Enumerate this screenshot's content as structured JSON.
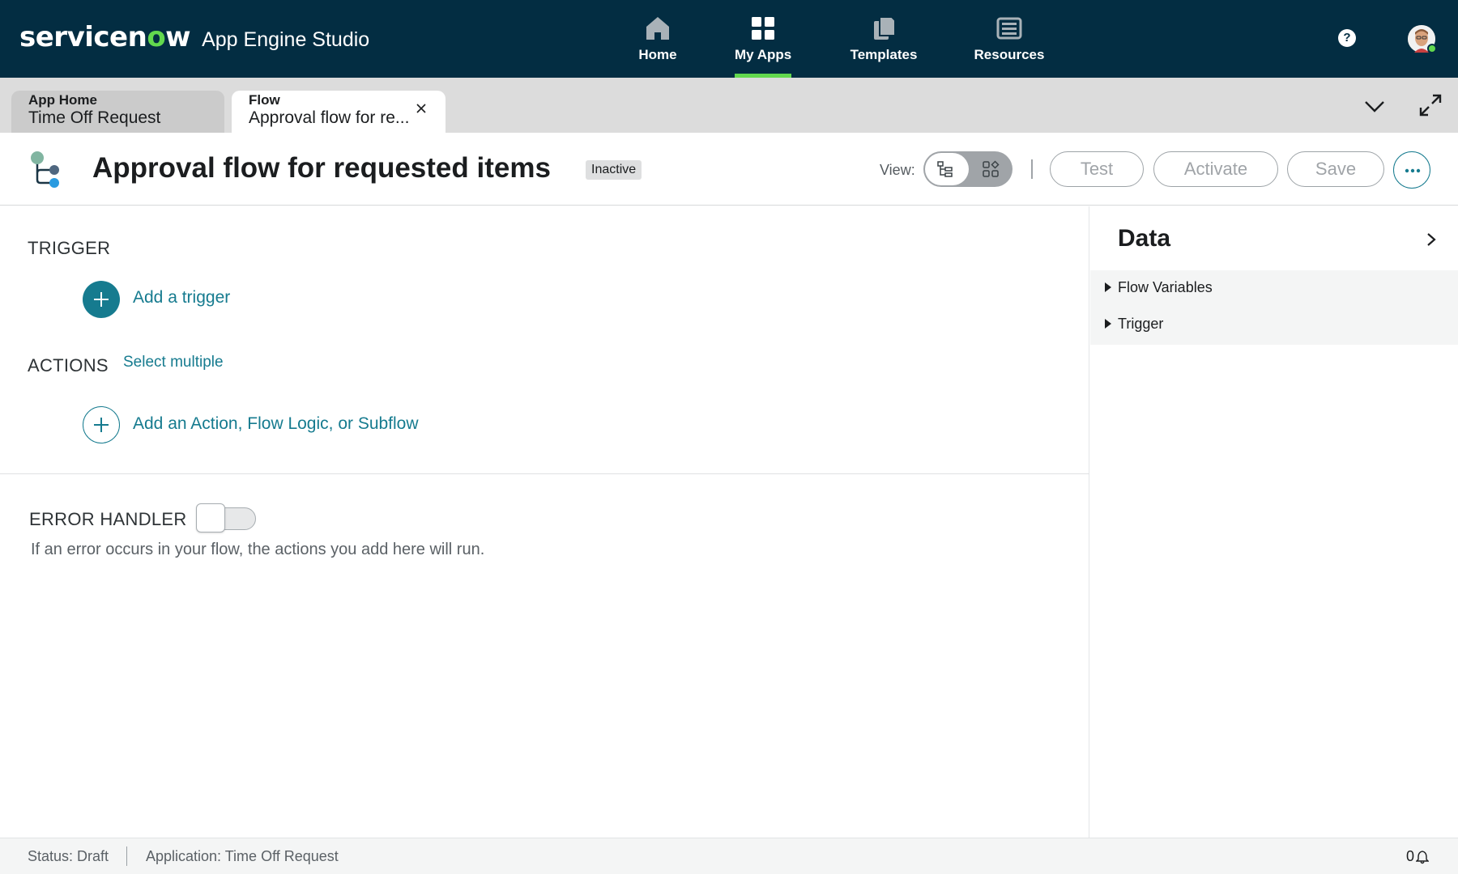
{
  "brand": {
    "logo_prefix": "servicen",
    "logo_o": "o",
    "logo_suffix": "w",
    "app_name": "App Engine Studio"
  },
  "nav": {
    "items": [
      {
        "label": "Home",
        "icon": "home-icon"
      },
      {
        "label": "My Apps",
        "icon": "grid-icon",
        "active": true
      },
      {
        "label": "Templates",
        "icon": "documents-icon"
      },
      {
        "label": "Resources",
        "icon": "newspaper-icon"
      }
    ],
    "help": "?"
  },
  "tabs": [
    {
      "kind": "App Home",
      "title": "Time Off Request"
    },
    {
      "kind": "Flow",
      "title": "Approval flow for re...",
      "active": true
    }
  ],
  "header": {
    "title": "Approval flow for requested items",
    "status": "Inactive",
    "view_label": "View:",
    "buttons": {
      "test": "Test",
      "activate": "Activate",
      "save": "Save"
    }
  },
  "canvas": {
    "trigger_heading": "TRIGGER",
    "add_trigger": "Add a trigger",
    "actions_heading": "ACTIONS",
    "select_multiple": "Select multiple",
    "add_action": "Add an Action, Flow Logic, or Subflow",
    "error_heading": "ERROR HANDLER",
    "error_description": "If an error occurs in your flow, the actions you add here will run.",
    "error_handler_enabled": false
  },
  "data_panel": {
    "title": "Data",
    "items": [
      "Flow Variables",
      "Trigger"
    ]
  },
  "statusbar": {
    "status": "Status: Draft",
    "application": "Application: Time Off Request",
    "notification_count": "0"
  },
  "colors": {
    "topbar": "#032d42",
    "accent_green": "#62d84e",
    "link_teal": "#167b8f"
  }
}
